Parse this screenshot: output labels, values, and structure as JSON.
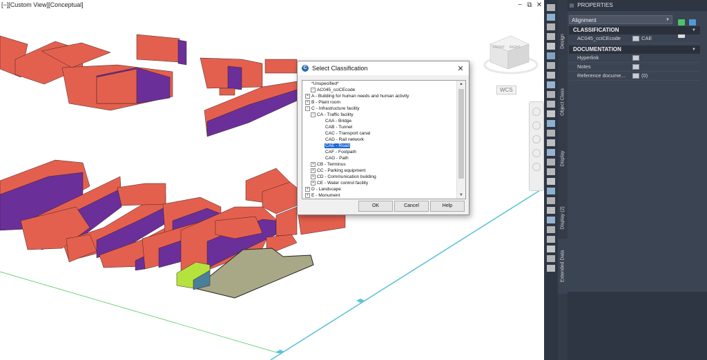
{
  "viewport": {
    "label": "[−][Custom View][Conceptual]",
    "window_controls": [
      "−",
      "⧉",
      "✕"
    ],
    "viewcube": {
      "face_front": "FRONT",
      "face_right": "RIGHT"
    },
    "ucs_label": "WCS"
  },
  "dialog": {
    "title": "Select Classification",
    "close": "✕",
    "tree": [
      {
        "text": "*Unspecified*",
        "level": 1,
        "expander": ""
      },
      {
        "text": "AC045_cciCEcode",
        "level": 0,
        "expander": "−"
      },
      {
        "text": "A - Building for human needs and human activity",
        "level": 1,
        "expander": "+"
      },
      {
        "text": "B - Plant room",
        "level": 1,
        "expander": "+"
      },
      {
        "text": "C - Infrastructure facility",
        "level": 1,
        "expander": "−"
      },
      {
        "text": "CA - Traffic facility",
        "level": 2,
        "expander": "−"
      },
      {
        "text": "CAA - Bridge",
        "level": 3,
        "expander": ""
      },
      {
        "text": "CAB - Tunnel",
        "level": 3,
        "expander": ""
      },
      {
        "text": "CAC - Transport canal",
        "level": 3,
        "expander": ""
      },
      {
        "text": "CAD - Rail network",
        "level": 3,
        "expander": ""
      },
      {
        "text": "CAE - Road",
        "level": 3,
        "expander": "",
        "selected": true
      },
      {
        "text": "CAF - Footpath",
        "level": 3,
        "expander": ""
      },
      {
        "text": "CAG - Path",
        "level": 3,
        "expander": ""
      },
      {
        "text": "CB - Terminus",
        "level": 2,
        "expander": "+"
      },
      {
        "text": "CC - Parking equipment",
        "level": 2,
        "expander": "+"
      },
      {
        "text": "CD - Communication building",
        "level": 2,
        "expander": "+"
      },
      {
        "text": "CE - Water control facility",
        "level": 2,
        "expander": "+"
      },
      {
        "text": "D - Landscape",
        "level": 1,
        "expander": "+"
      },
      {
        "text": "E - Monument",
        "level": 1,
        "expander": "+"
      }
    ],
    "buttons": {
      "ok": "OK",
      "cancel": "Cancel",
      "help": "Help"
    }
  },
  "properties": {
    "title": "PROPERTIES",
    "object_type": "Alignment",
    "side_tabs": [
      "Design",
      "Object Class",
      "Display",
      "Display (2)",
      "Extended Data"
    ],
    "active_tab": "Extended Data",
    "categories": [
      {
        "name": "CLASSIFICATION",
        "rows": [
          {
            "name": "AC045_cciCEcode",
            "value": "CAE"
          }
        ]
      },
      {
        "name": "DOCUMENTATION",
        "rows": [
          {
            "name": "Hyperlink",
            "value": ""
          },
          {
            "name": "Notes",
            "value": ""
          },
          {
            "name": "Reference docume...",
            "value": "(0)"
          }
        ]
      }
    ]
  },
  "colors": {
    "building_roof": "#e4604e",
    "building_side": "#6b2f9a",
    "selected_building": "#b6e23d",
    "road_line": "#5bc3db",
    "ground_poly": "#a8a886",
    "panel_bg": "#3b4453",
    "selection_blue": "#1e67d2"
  }
}
